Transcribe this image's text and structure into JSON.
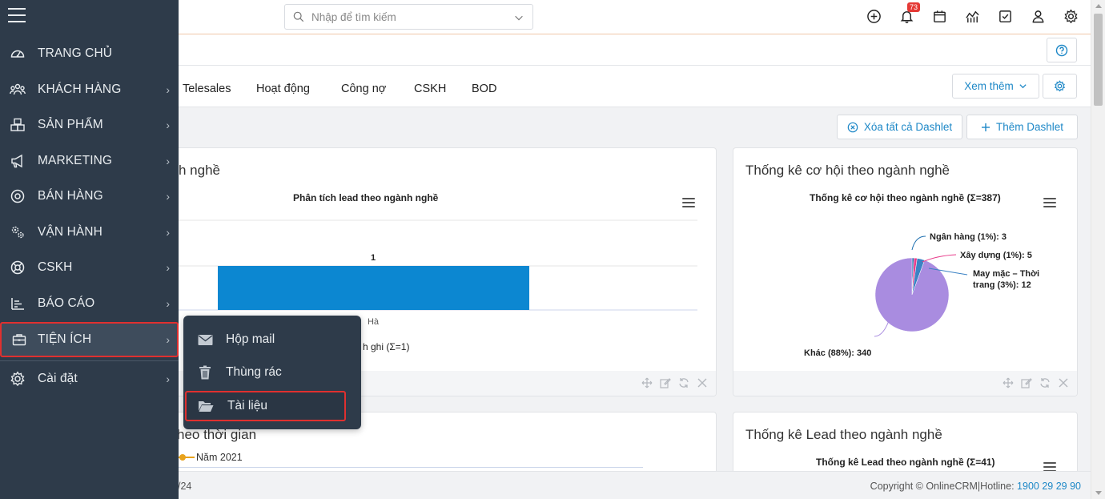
{
  "search": {
    "placeholder": "Nhập để tìm kiếm"
  },
  "notifications": {
    "count": "73"
  },
  "tabs": [
    "Telesales",
    "Hoạt động",
    "Công nợ",
    "CSKH",
    "BOD"
  ],
  "toolbar": {
    "more_label": "Xem thêm",
    "clear_label": "Xóa tất cả Dashlet",
    "add_label": "Thêm Dashlet"
  },
  "sidebar": {
    "items": [
      {
        "label": "TRANG CHỦ",
        "icon": "dashboard-icon"
      },
      {
        "label": "KHÁCH HÀNG",
        "icon": "users-icon"
      },
      {
        "label": "SẢN PHẨM",
        "icon": "boxes-icon"
      },
      {
        "label": "MARKETING",
        "icon": "megaphone-icon"
      },
      {
        "label": "BÁN HÀNG",
        "icon": "target-icon"
      },
      {
        "label": "VẬN HÀNH",
        "icon": "cogs-icon"
      },
      {
        "label": "CSKH",
        "icon": "lifebuoy-icon"
      },
      {
        "label": "BÁO CÁO",
        "icon": "report-icon"
      },
      {
        "label": "TIỆN ÍCH",
        "icon": "briefcase-icon"
      },
      {
        "label": "Cài đặt",
        "icon": "gear-icon"
      }
    ]
  },
  "submenu": {
    "items": [
      {
        "label": "Hộp mail",
        "icon": "envelope-icon"
      },
      {
        "label": "Thùng rác",
        "icon": "trash-icon"
      },
      {
        "label": "Tài liệu",
        "icon": "folder-open-icon"
      }
    ]
  },
  "cards": {
    "lead_industry": {
      "title_fragment": "h nghề",
      "chart_title": "Phân tích lead theo ngành nghề",
      "legend_fragment": "h ghi (Σ=1)",
      "value_label": "1",
      "category_fragment": "Hà"
    },
    "opportunity": {
      "title": "Thống kê cơ hội theo ngành nghề",
      "chart_title": "Thống kê cơ hội theo ngành nghề (Σ=387)",
      "labels": [
        "Ngân hàng (1%): 3",
        "Xây dựng (1%): 5",
        "May mặc – Thời trang (3%): 12",
        "Khác (88%): 340"
      ]
    },
    "time": {
      "title_fragment": "heo thời gian",
      "legend": "Năm 2021"
    },
    "lead_stats": {
      "title": "Thống kê Lead theo ngành nghề",
      "chart_title": "Thống kê Lead theo ngành nghề (Σ=41)"
    }
  },
  "footer": {
    "date_fragment": "/24",
    "copyright": "Copyright © OnlineCRM|Hotline:",
    "hotline": "1900 29 29 90"
  },
  "chart_data": [
    {
      "type": "bar",
      "title": "Phân tích lead theo ngành nghề",
      "categories": [
        "Hà"
      ],
      "values": [
        1
      ]
    },
    {
      "type": "pie",
      "title": "Thống kê cơ hội theo ngành nghề (Σ=387)",
      "categories": [
        "Ngân hàng",
        "Xây dựng",
        "May mặc – Thời trang",
        "Khác"
      ],
      "values": [
        3,
        5,
        12,
        340
      ],
      "colors": [
        "#1e6fb0",
        "#e83e8c",
        "#3b82c4",
        "#a98ce0"
      ]
    }
  ]
}
